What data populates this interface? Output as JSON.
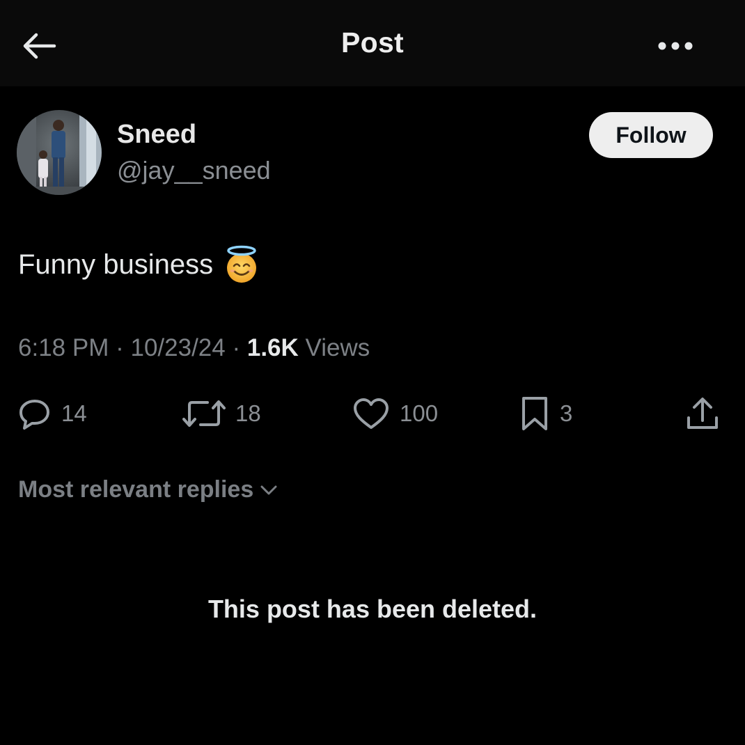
{
  "header": {
    "title": "Post",
    "back_icon": "arrow-left-icon",
    "more_icon": "more-horizontal-icon"
  },
  "author": {
    "display_name": "Sneed",
    "handle": "@jay__sneed",
    "follow_label": "Follow"
  },
  "post": {
    "text": "Funny business",
    "emoji_icon": "smiling-face-with-halo-icon",
    "time": "6:18 PM",
    "date": "10/23/24",
    "views_count": "1.6K",
    "views_label": "Views",
    "separator": "·"
  },
  "actions": {
    "replies": "14",
    "reposts": "18",
    "likes": "100",
    "bookmarks": "3"
  },
  "replies": {
    "sort_label": "Most relevant replies",
    "deleted_notice": "This post has been deleted."
  },
  "colors": {
    "background": "#000000",
    "header_background": "#0a0a0a",
    "primary_text": "#e7e9ea",
    "secondary_text": "#8b8f94",
    "follow_button_bg": "#eeeeee"
  }
}
